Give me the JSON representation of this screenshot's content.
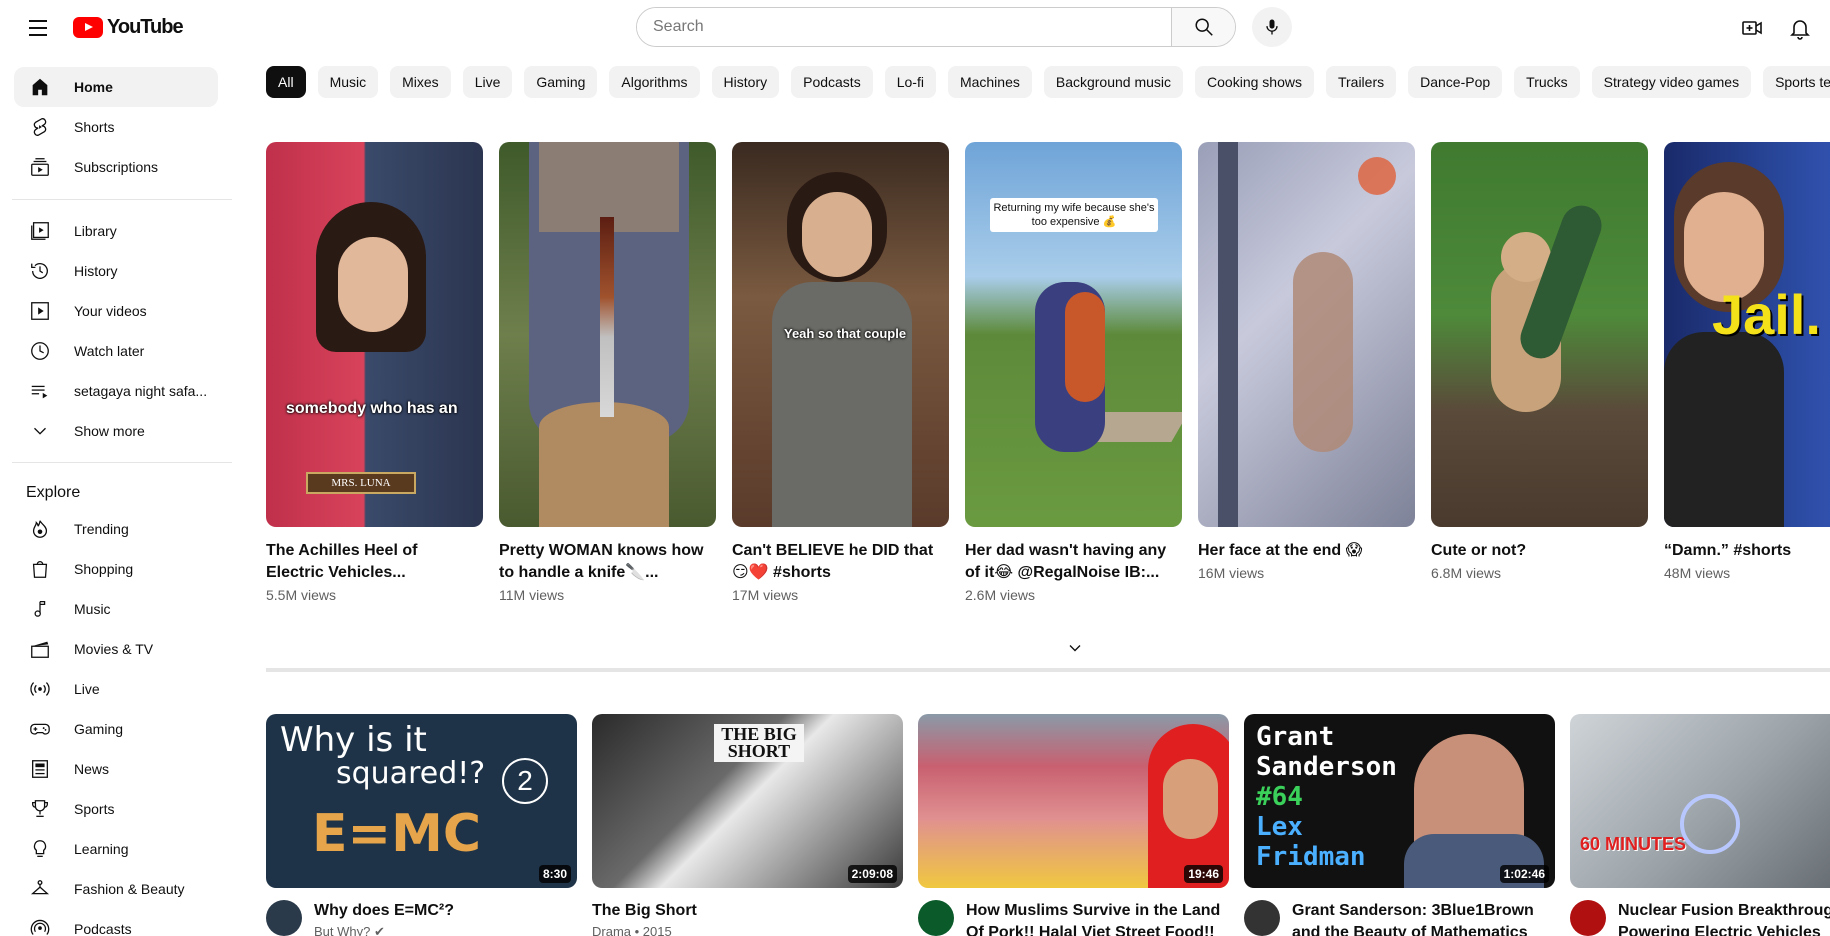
{
  "header": {
    "logo_text": "YouTube",
    "search_placeholder": "Search"
  },
  "sidebar": {
    "main": [
      {
        "label": "Home",
        "icon": "home-icon",
        "active": true
      },
      {
        "label": "Shorts",
        "icon": "shorts-icon"
      },
      {
        "label": "Subscriptions",
        "icon": "subscriptions-icon"
      }
    ],
    "you": [
      {
        "label": "Library",
        "icon": "library-icon"
      },
      {
        "label": "History",
        "icon": "history-icon"
      },
      {
        "label": "Your videos",
        "icon": "your-videos-icon"
      },
      {
        "label": "Watch later",
        "icon": "watch-later-icon"
      },
      {
        "label": "setagaya night safa...",
        "icon": "playlist-icon"
      },
      {
        "label": "Show more",
        "icon": "chevron-down-icon"
      }
    ],
    "explore_heading": "Explore",
    "explore": [
      {
        "label": "Trending",
        "icon": "trending-icon"
      },
      {
        "label": "Shopping",
        "icon": "shopping-icon"
      },
      {
        "label": "Music",
        "icon": "music-icon"
      },
      {
        "label": "Movies & TV",
        "icon": "movies-icon"
      },
      {
        "label": "Live",
        "icon": "live-icon"
      },
      {
        "label": "Gaming",
        "icon": "gaming-icon"
      },
      {
        "label": "News",
        "icon": "news-icon"
      },
      {
        "label": "Sports",
        "icon": "sports-icon"
      },
      {
        "label": "Learning",
        "icon": "learning-icon"
      },
      {
        "label": "Fashion & Beauty",
        "icon": "fashion-icon"
      },
      {
        "label": "Podcasts",
        "icon": "podcasts-icon"
      }
    ]
  },
  "chips": [
    "All",
    "Music",
    "Mixes",
    "Live",
    "Gaming",
    "Algorithms",
    "History",
    "Podcasts",
    "Lo-fi",
    "Machines",
    "Background music",
    "Cooking shows",
    "Trailers",
    "Dance-Pop",
    "Trucks",
    "Strategy video games",
    "Sports te"
  ],
  "shorts": [
    {
      "title": "The Achilles Heel of Electric Vehicles...",
      "views": "5.5M views",
      "caption": "somebody who has an",
      "nameplate": "MRS. LUNA"
    },
    {
      "title": "Pretty WOMAN knows how to handle a knife🔪...",
      "views": "11M views"
    },
    {
      "title": "Can't BELIEVE he DID that 😏❤️ #shorts",
      "views": "17M views",
      "caption": "Yeah so that couple"
    },
    {
      "title": "Her dad wasn't having any of it😂 @RegalNoise IB:...",
      "views": "2.6M views",
      "caption": "Returning my wife because she's too expensive 💰"
    },
    {
      "title": "Her face at the end 😱",
      "views": "16M views"
    },
    {
      "title": "Cute or not?",
      "views": "6.8M views"
    },
    {
      "title": "“Damn.” #shorts",
      "views": "48M views",
      "caption": "Jail."
    }
  ],
  "videos": [
    {
      "title": "Why does E=MC²?",
      "channel": "But Why? ✔",
      "duration": "8:30",
      "thumb_line1": "Why is it",
      "thumb_line2": "squared!?",
      "thumb_formula": "E=MC",
      "thumb_badge": "2"
    },
    {
      "title": "The Big Short",
      "channel": "Drama • 2015",
      "duration": "2:09:08",
      "thumb_text": "THE BIG SHORT"
    },
    {
      "title": "How Muslims Survive in the Land Of Pork!! Halal Viet Street Food!!",
      "channel": "",
      "duration": "19:46"
    },
    {
      "title": "Grant Sanderson: 3Blue1Brown and the Beauty of Mathematics",
      "channel": "",
      "duration": "1:02:46",
      "thumb_name1": "Grant",
      "thumb_name2": "Sanderson",
      "thumb_num": "#64",
      "thumb_host1": "Lex",
      "thumb_host2": "Fridman"
    },
    {
      "title": "Nuclear Fusion Breakthrough; Powering Electric Vehicles",
      "channel": "",
      "duration": "",
      "thumb_logo": "60 MINUTES"
    }
  ]
}
